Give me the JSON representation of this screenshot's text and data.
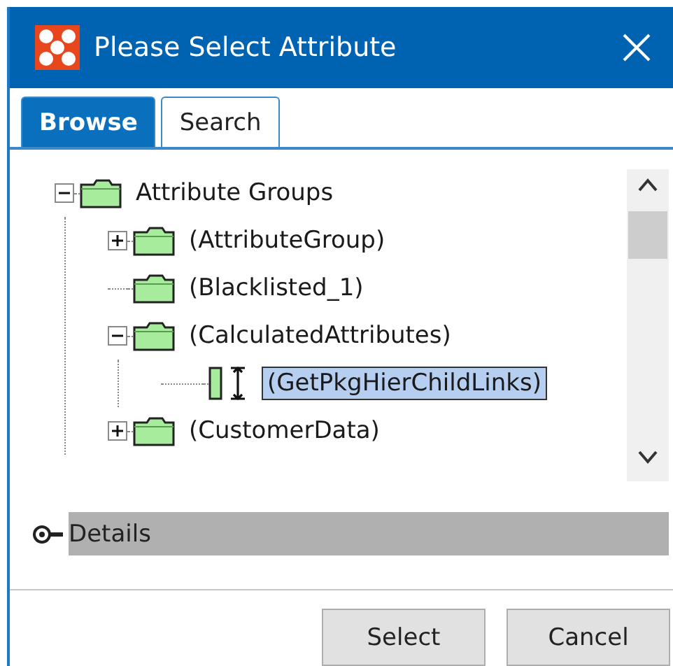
{
  "window": {
    "title": "Please Select Attribute"
  },
  "tabs": [
    {
      "label": "Browse",
      "selected": true
    },
    {
      "label": "Search",
      "selected": false
    }
  ],
  "tree": [
    {
      "label": "Attribute Groups",
      "kind": "folder",
      "expanded": true,
      "selected": false,
      "children": [
        {
          "label": "(AttributeGroup)",
          "kind": "folder",
          "expanded": false,
          "selected": false
        },
        {
          "label": "(Blacklisted_1)",
          "kind": "folder",
          "selected": false
        },
        {
          "label": "(CalculatedAttributes)",
          "kind": "folder",
          "expanded": true,
          "selected": false,
          "children": [
            {
              "label": "(GetPkgHierChildLinks)",
              "kind": "attribute",
              "selected": true
            }
          ]
        },
        {
          "label": "(CustomerData)",
          "kind": "folder",
          "expanded": false,
          "selected": false
        }
      ]
    }
  ],
  "details": {
    "label": "Details",
    "expanded": false
  },
  "buttons": [
    "Select",
    "Cancel"
  ]
}
